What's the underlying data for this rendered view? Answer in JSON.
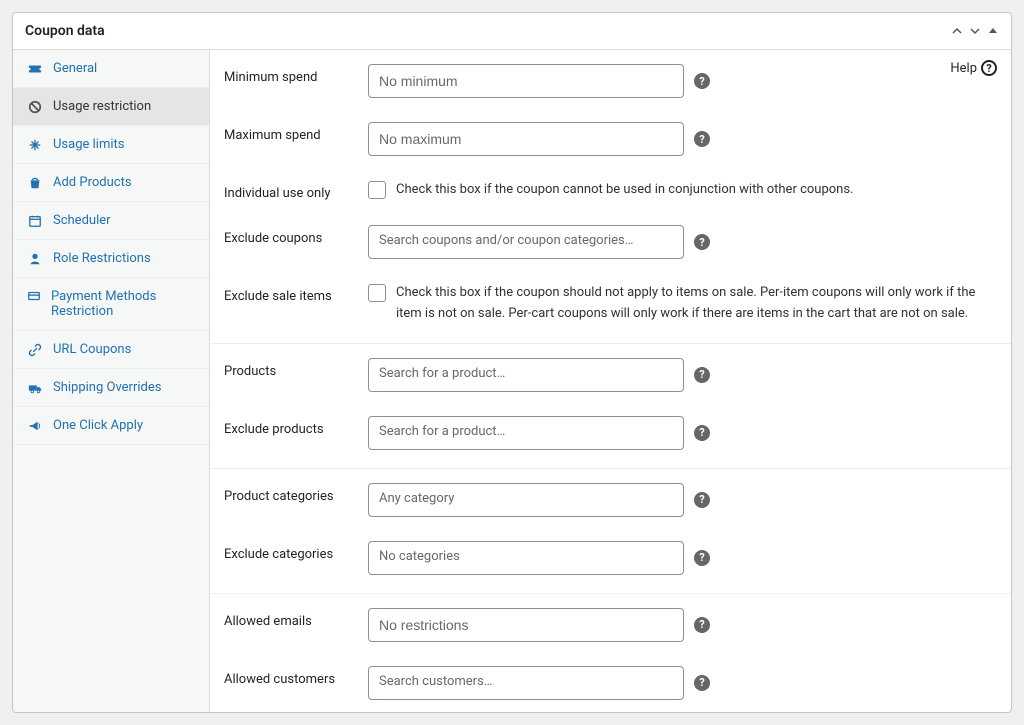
{
  "panel": {
    "title": "Coupon data"
  },
  "help": {
    "label": "Help"
  },
  "sidebar": {
    "items": [
      {
        "label": "General"
      },
      {
        "label": "Usage restriction"
      },
      {
        "label": "Usage limits"
      },
      {
        "label": "Add Products"
      },
      {
        "label": "Scheduler"
      },
      {
        "label": "Role Restrictions"
      },
      {
        "label": "Payment Methods Restriction"
      },
      {
        "label": "URL Coupons"
      },
      {
        "label": "Shipping Overrides"
      },
      {
        "label": "One Click Apply"
      }
    ]
  },
  "fields": {
    "minimum_spend": {
      "label": "Minimum spend",
      "placeholder": "No minimum"
    },
    "maximum_spend": {
      "label": "Maximum spend",
      "placeholder": "No maximum"
    },
    "individual_use": {
      "label": "Individual use only",
      "desc": "Check this box if the coupon cannot be used in conjunction with other coupons."
    },
    "exclude_coupons": {
      "label": "Exclude coupons",
      "placeholder": "Search coupons and/or coupon categories…"
    },
    "exclude_sale": {
      "label": "Exclude sale items",
      "desc": "Check this box if the coupon should not apply to items on sale. Per-item coupons will only work if the item is not on sale. Per-cart coupons will only work if there are items in the cart that are not on sale."
    },
    "products": {
      "label": "Products",
      "placeholder": "Search for a product…"
    },
    "exclude_products": {
      "label": "Exclude products",
      "placeholder": "Search for a product…"
    },
    "product_categories": {
      "label": "Product categories",
      "placeholder": "Any category"
    },
    "exclude_categories": {
      "label": "Exclude categories",
      "placeholder": "No categories"
    },
    "allowed_emails": {
      "label": "Allowed emails",
      "placeholder": "No restrictions"
    },
    "allowed_customers": {
      "label": "Allowed customers",
      "placeholder": "Search customers…"
    }
  }
}
